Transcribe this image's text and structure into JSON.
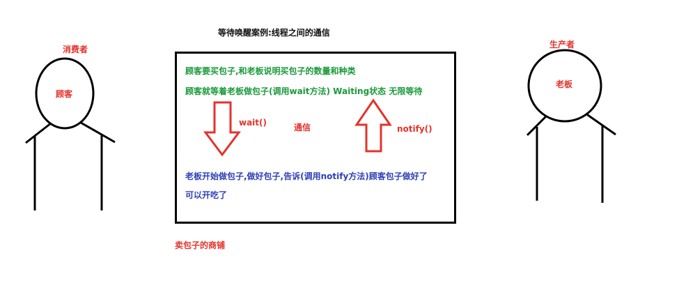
{
  "title": "等待唤醒案例:线程之间的通信",
  "consumer": {
    "role": "消费者",
    "name": "顾客"
  },
  "producer": {
    "role": "生产者",
    "name": "老板"
  },
  "shop": {
    "line1": "顾客要买包子,和老板说明买包子的数量和种类",
    "line2": "顾客就等着老板做包子(调用wait方法)   Waiting状态 无限等待",
    "wait_label": "wait()",
    "comm_label": "通信",
    "notify_label": "notify()",
    "line3": "老板开始做包子,做好包子,告诉(调用notify方法)顾客包子做好了",
    "line4": "可以开吃了",
    "caption": "卖包子的商铺"
  },
  "colors": {
    "red": "#e4322b",
    "green": "#1a9a3a",
    "blue": "#2c3fb8",
    "black": "#111111"
  }
}
